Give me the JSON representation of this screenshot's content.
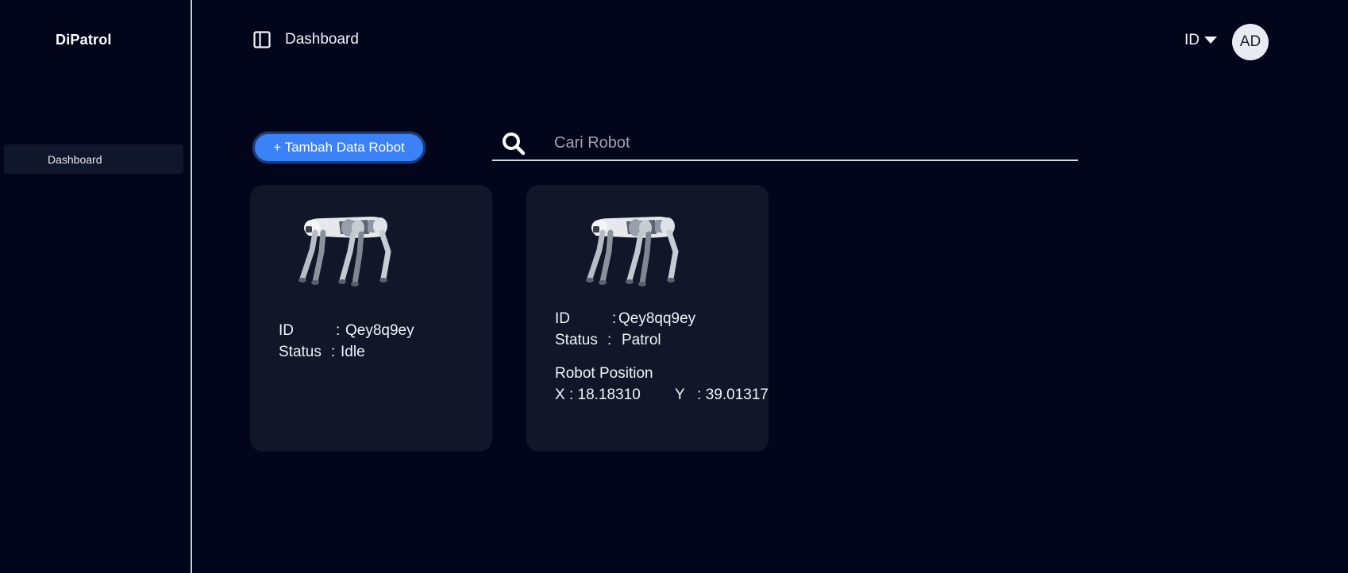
{
  "app": {
    "brand": "DiPatrol"
  },
  "sidebar": {
    "items": [
      {
        "label": "Dashboard"
      }
    ]
  },
  "header": {
    "title": "Dashboard",
    "language": "ID",
    "avatar_initials": "AD"
  },
  "toolbar": {
    "add_button_label": "+ Tambah Data Robot",
    "search_placeholder": "Cari Robot",
    "search_value": ""
  },
  "robots": [
    {
      "id_label": "ID",
      "id_value": "Qey8q9ey",
      "status_label": "Status",
      "status_value": "Idle"
    },
    {
      "id_label": "ID",
      "id_value": "Qey8qq9ey",
      "status_label": "Status",
      "status_value": "Patrol",
      "position_title": "Robot Position",
      "x_label": "X",
      "x_value": "18.18310",
      "y_label": "Y",
      "y_value": "39.01317"
    }
  ],
  "colors": {
    "background": "#03061a",
    "card": "#111729",
    "accent": "#3b82f6",
    "text": "#f1f3f9"
  },
  "icons": {
    "sidebar_toggle": "panel-icon",
    "language_dropdown": "caret-down-icon",
    "search": "search-icon"
  }
}
